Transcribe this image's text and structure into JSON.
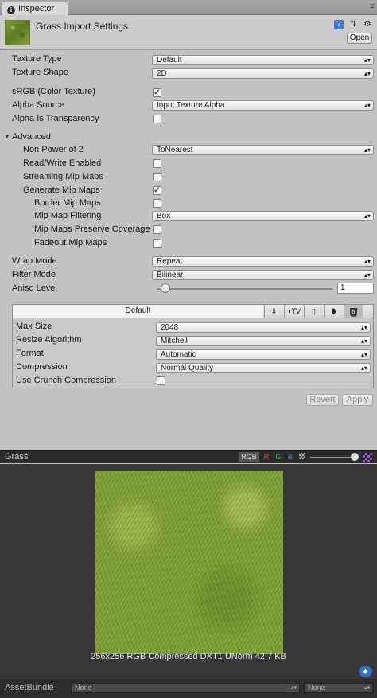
{
  "window": {
    "tab_label": "Inspector",
    "menu_glyph": "≡"
  },
  "header": {
    "title": "Grass Import Settings",
    "open_label": "Open"
  },
  "settings": {
    "texture_type": {
      "label": "Texture Type",
      "value": "Default"
    },
    "texture_shape": {
      "label": "Texture Shape",
      "value": "2D"
    },
    "srgb": {
      "label": "sRGB (Color Texture)",
      "checked": true
    },
    "alpha_source": {
      "label": "Alpha Source",
      "value": "Input Texture Alpha"
    },
    "alpha_transparency": {
      "label": "Alpha Is Transparency",
      "checked": false
    },
    "advanced_label": "Advanced",
    "non_power_of_2": {
      "label": "Non Power of 2",
      "value": "ToNearest"
    },
    "read_write": {
      "label": "Read/Write Enabled",
      "checked": false
    },
    "streaming_mips": {
      "label": "Streaming Mip Maps",
      "checked": false
    },
    "generate_mips": {
      "label": "Generate Mip Maps",
      "checked": true
    },
    "border_mips": {
      "label": "Border Mip Maps",
      "checked": false
    },
    "mip_filtering": {
      "label": "Mip Map Filtering",
      "value": "Box"
    },
    "mip_coverage": {
      "label": "Mip Maps Preserve Coverage",
      "checked": false
    },
    "fadeout_mips": {
      "label": "Fadeout Mip Maps",
      "checked": false
    },
    "wrap_mode": {
      "label": "Wrap Mode",
      "value": "Repeat"
    },
    "filter_mode": {
      "label": "Filter Mode",
      "value": "Bilinear"
    },
    "aniso": {
      "label": "Aniso Level",
      "value": "1"
    }
  },
  "platform": {
    "default_tab": "Default",
    "tab_icons": [
      "download-icon",
      "apple-tv-icon",
      "phone-icon",
      "android-icon",
      "html5-icon"
    ],
    "tv_label": "TV",
    "html5_label": "5",
    "max_size": {
      "label": "Max Size",
      "value": "2048"
    },
    "resize": {
      "label": "Resize Algorithm",
      "value": "Mitchell"
    },
    "format": {
      "label": "Format",
      "value": "Automatic"
    },
    "compression": {
      "label": "Compression",
      "value": "Normal Quality"
    },
    "crunch": {
      "label": "Use Crunch Compression",
      "checked": false
    }
  },
  "actions": {
    "revert": "Revert",
    "apply": "Apply"
  },
  "preview": {
    "name": "Grass",
    "rgb_label": "RGB",
    "channels": {
      "r": "R",
      "g": "G",
      "b": "B"
    },
    "info": "256x256  RGB Compressed DXT1 UNorm   42.7 KB"
  },
  "assetbundle": {
    "label": "AssetBundle",
    "name_value": "None",
    "variant_value": "None"
  },
  "colors": {
    "accent": "#2f6fd0",
    "preview_bg": "#383838",
    "panel_bg": "#c2c2c2"
  }
}
